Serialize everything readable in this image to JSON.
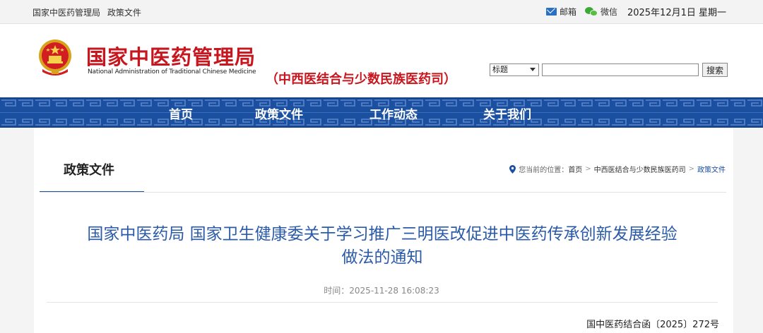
{
  "topbar": {
    "breadcrumb": [
      "国家中医药管理局",
      "政策文件"
    ],
    "mail": {
      "label": "邮箱",
      "icon": "mail-icon"
    },
    "wechat": {
      "label": "微信",
      "icon": "wechat-icon"
    },
    "date": "2025年12月1日 星期一"
  },
  "header": {
    "site_name": "国家中医药管理局",
    "site_name_en": "National Administration of Traditional Chinese Medicine",
    "sub_department": "（中西医结合与少数民族医药司）",
    "emblem_icon": "national-emblem-icon",
    "search": {
      "select_value": "标题",
      "input_value": "",
      "button_label": "搜索"
    }
  },
  "nav": {
    "items": [
      {
        "label": "首页"
      },
      {
        "label": "政策文件"
      },
      {
        "label": "工作动态"
      },
      {
        "label": "关于我们"
      }
    ],
    "color": "#1b4fa0"
  },
  "section": {
    "title": "政策文件",
    "location_label": "您当前的位置：",
    "crumbs": [
      "首页",
      "中西医结合与少数民族医药司",
      "政策文件"
    ]
  },
  "article": {
    "title_line1": "国家中医药局 国家卫生健康委关于学习推广三明医改促进中医药传承创新发展经验",
    "title_line2": "做法的通知",
    "time_label": "时间：",
    "time_value": "2025-11-28 16:08:23",
    "doc_number": "国中医药结合函〔2025〕272号"
  },
  "colors": {
    "brand_red": "#c8161e",
    "brand_blue": "#1b4fa0",
    "title_blue": "#2b5ba8"
  }
}
